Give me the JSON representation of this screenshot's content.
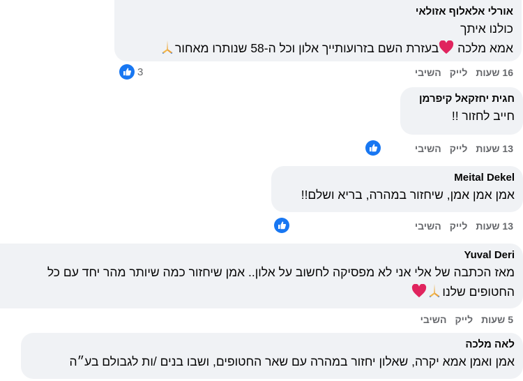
{
  "comments": [
    {
      "author": "אורלי אלאלוף אזולאי",
      "line1": "כולנו איתך",
      "line2_part1": "אמא מלכה ",
      "line2_part2": "בעזרת השם בזרועותייך אלון וכל ה-58 שנותרו מאחור",
      "time": "16 שעות",
      "like_label": "לייק",
      "reply_label": "השיבי",
      "reaction_count": "3",
      "emojis": [
        "heart-emoji",
        "pray-emoji"
      ]
    },
    {
      "author": "חגית יחזקאל קיפרמן",
      "line1": "חייב לחזור !!",
      "time": "13 שעות",
      "like_label": "לייק",
      "reply_label": "השיבי",
      "reaction_count": ""
    },
    {
      "author": "Meital Dekel",
      "line1": "אמן אמן אמן, שיחזור במהרה, בריא ושלם!!",
      "time": "13 שעות",
      "like_label": "לייק",
      "reply_label": "השיבי",
      "reaction_count": ""
    },
    {
      "author": "Yuval Deri",
      "line1": "מאז הכתבה של אלי אני לא מפסיקה לחשוב על אלון.. אמן שיחזור כמה שיותר מהר יחד עם כל",
      "line2": "החטופים שלנו",
      "time": "5 שעות",
      "like_label": "לייק",
      "reply_label": "השיבי",
      "emojis": [
        "pray-emoji",
        "heart-emoji"
      ]
    },
    {
      "author": "לאה מלכה",
      "line1": "אמן ואמן אמא יקרה, שאלון יחזור במהרה עם שאר החטופים, ושבו בנים /ות לגבולם בע״ה"
    }
  ],
  "colors": {
    "bubble": "#f0f2f5",
    "meta_text": "#65676b",
    "like_blue": "#1877f2",
    "heart_red": "#e0245e"
  }
}
